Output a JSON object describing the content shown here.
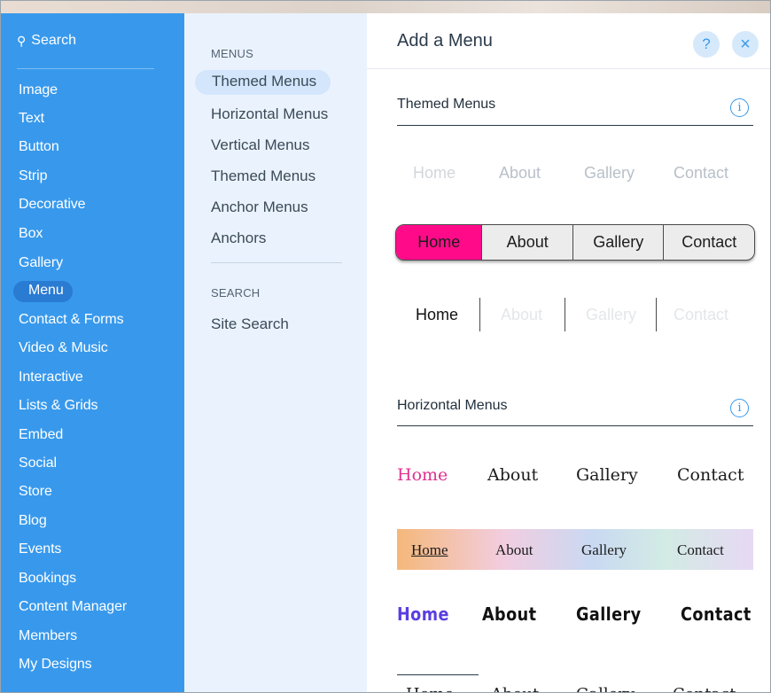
{
  "left_nav": {
    "search_label": "Search",
    "categories": [
      "Image",
      "Text",
      "Button",
      "Strip",
      "Decorative",
      "Box",
      "Gallery",
      "Menu",
      "Contact & Forms",
      "Video & Music",
      "Interactive",
      "Lists & Grids",
      "Embed",
      "Social",
      "Store",
      "Blog",
      "Events",
      "Bookings",
      "Content Manager",
      "Members",
      "My Designs"
    ],
    "active": "Menu"
  },
  "sub_nav": {
    "menus_header": "MENUS",
    "menu_items": [
      "Themed Menus",
      "Horizontal Menus",
      "Vertical Menus",
      "Themed Menus",
      "Anchor Menus",
      "Anchors"
    ],
    "selected": "Themed Menus",
    "search_header": "SEARCH",
    "search_items": [
      "Site Search"
    ]
  },
  "panel": {
    "title": "Add a Menu",
    "help_icon": "?",
    "close_icon": "×",
    "info_icon": "i",
    "themed_section_title": "Themed Menus",
    "horizontal_section_title": "Horizontal Menus",
    "menu_labels": [
      "Home",
      "About",
      "Gallery",
      "Contact"
    ]
  },
  "colors": {
    "nav_blue": "#3899ec",
    "active_pink": "#ff0b8a",
    "bold_home": "#5b3fe0",
    "serif_home": "#e0318f"
  }
}
